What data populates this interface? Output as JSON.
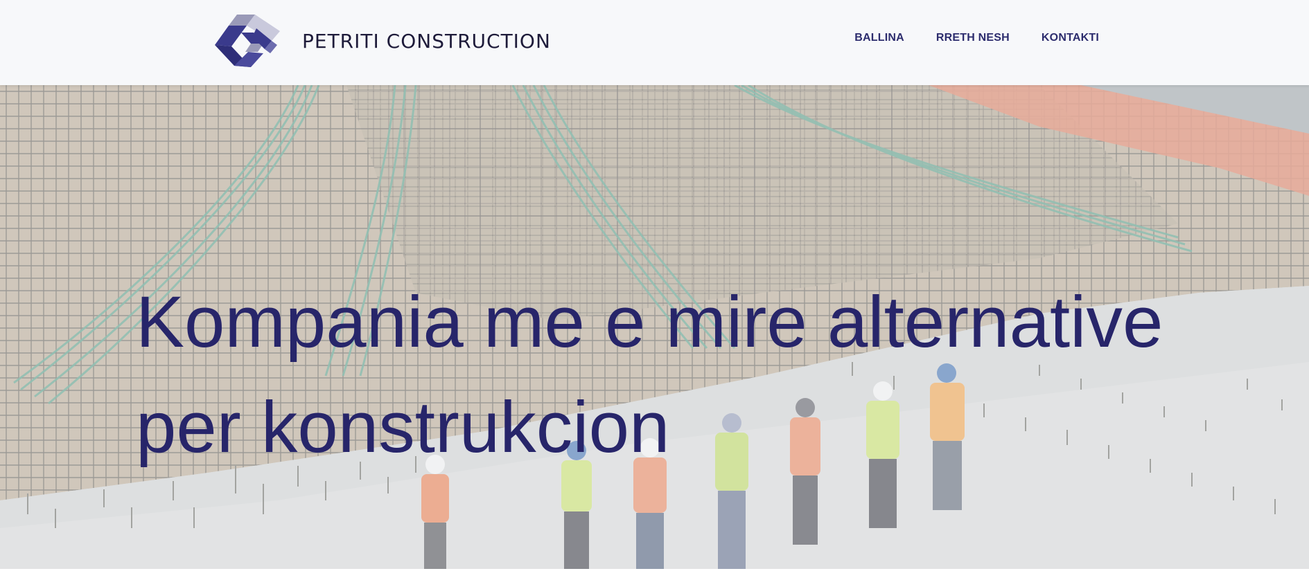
{
  "header": {
    "brand_name": "PETRITI CONSTRUCTION",
    "logo_icon": "petriti-logo-icon",
    "nav": [
      {
        "label": "BALLINA"
      },
      {
        "label": "RRETH NESH"
      },
      {
        "label": "KONTAKTI"
      }
    ]
  },
  "hero": {
    "headline": "Kompania me e mire alternative per konstrukcion",
    "background_image": "construction site with rebar, cables and workers in hard hats"
  },
  "colors": {
    "header_bg": "#f7f8fa",
    "brand_text": "#1e1b3a",
    "nav_text": "#2d2d6e",
    "headline": "#27256a",
    "logo_primary": "#3a3a8c",
    "logo_secondary": "#9a9ab8"
  }
}
